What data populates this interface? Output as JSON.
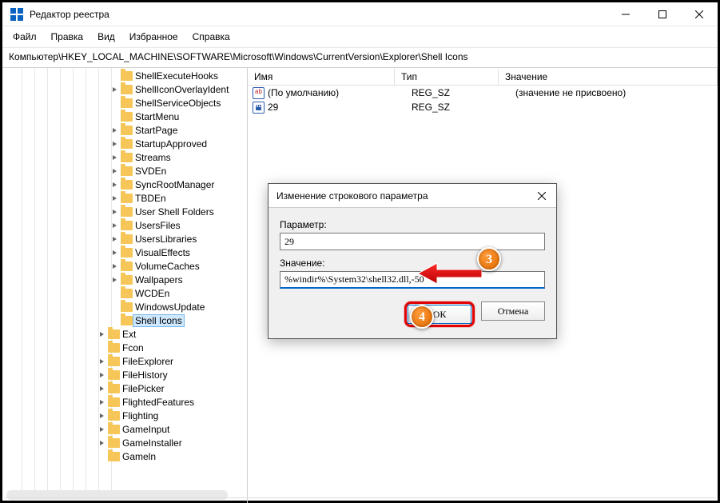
{
  "titlebar": {
    "title": "Редактор реестра"
  },
  "menu": {
    "file": "Файл",
    "edit": "Правка",
    "view": "Вид",
    "fav": "Избранное",
    "help": "Справка"
  },
  "address": "Компьютер\\HKEY_LOCAL_MACHINE\\SOFTWARE\\Microsoft\\Windows\\CurrentVersion\\Explorer\\Shell Icons",
  "tree": [
    "ShellExecuteHooks",
    "ShellIconOverlayIdent",
    "ShellServiceObjects",
    "StartMenu",
    "StartPage",
    "StartupApproved",
    "Streams",
    "SVDEn",
    "SyncRootManager",
    "TBDEn",
    "User Shell Folders",
    "UsersFiles",
    "UsersLibraries",
    "VisualEffects",
    "VolumeCaches",
    "Wallpapers",
    "WCDEn",
    "WindowsUpdate",
    "Shell Icons"
  ],
  "tree2": [
    "Ext",
    "Fcon",
    "FileExplorer",
    "FileHistory",
    "FilePicker",
    "FlightedFeatures",
    "Flighting",
    "GameInput",
    "GameInstaller",
    "Gameln"
  ],
  "list": {
    "cols": {
      "name": "Имя",
      "type": "Тип",
      "value": "Значение"
    },
    "rows": [
      {
        "name": "(По умолчанию)",
        "type": "REG_SZ",
        "value": "(значение не присвоено)"
      },
      {
        "name": "29",
        "type": "REG_SZ",
        "value": ""
      }
    ]
  },
  "dialog": {
    "title": "Изменение строкового параметра",
    "param_label": "Параметр:",
    "param_value": "29",
    "value_label": "Значение:",
    "value_value": "%windir%\\System32\\shell32.dll,-50",
    "ok": "ОК",
    "cancel": "Отмена"
  },
  "badges": {
    "a": "3",
    "b": "4"
  }
}
